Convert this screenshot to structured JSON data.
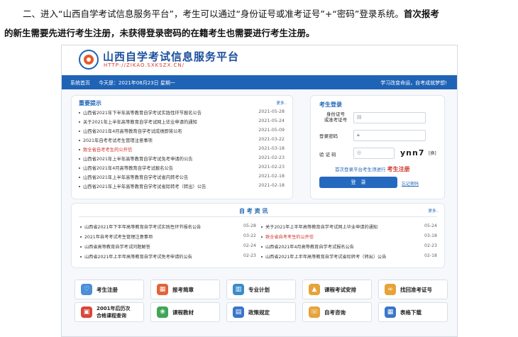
{
  "intro": {
    "line1_normal": "二、进入“山西自学考试信息服务平台”，考生可以通过“身份证号或准考证号”+“密码”登录系统。",
    "line1_bold": "首次报考",
    "line2_bold": "的新生需要先进行考生注册，未获得登录密码的在籍考生也需要进行考生注册。"
  },
  "header": {
    "title": "山西自学考试信息服务平台",
    "url": "HTTP://ZIKAO.SXKSZX.CN/"
  },
  "nav": {
    "home": "系统首页",
    "today": "今天是：2021年08月23日   星期一",
    "slogan": "学习改变命运，自考成就梦想!"
  },
  "notices": {
    "title": "重要提示",
    "more": "更多..",
    "items": [
      {
        "text": "山西省2021年下半年高等教育自学考试实践性环节报名公告",
        "date": "2021-05-28"
      },
      {
        "text": "关于2021年上半年高等教育自学考试网上毕业申请的通知",
        "date": "2021-05-24"
      },
      {
        "text": "山西省2021年4月高等教育自学考试成绩即将公布",
        "date": "2021-05-09"
      },
      {
        "text": "2021年自考考试考生管理注意事项",
        "date": "2021-03-22"
      },
      {
        "text": "致全省自考考生的公开信",
        "date": "2021-03-18"
      },
      {
        "text": "山西省2021年上半年高等教育自学考试免考申请的公告",
        "date": "2021-02-23"
      },
      {
        "text": "山西省2021年4月高等教育自学考试报名公告",
        "date": "2021-02-23"
      },
      {
        "text": "山西省2021年上半年高等教育自学考试省内转考公告",
        "date": "2021-02-18"
      },
      {
        "text": "山西省2021年上半年高等教育自学考试省际转考（转出）公告",
        "date": "2021-02-18"
      }
    ]
  },
  "login": {
    "title": "考生登录",
    "id_label": "身份证号\n或准考证号",
    "password_label": "登录密码",
    "captcha_label": "验 证 码",
    "captcha_text": "ynn7",
    "change": "[换]",
    "register_hint": "首次登录平台考生须进行",
    "register_link": "考生注册",
    "login_button": "登　录",
    "forgot": "忘记密码"
  },
  "news": {
    "title": "自 考 资 讯",
    "more": "更多..",
    "left": [
      {
        "text": "山西省2021年下半年高等教育自学考试实践性环节报名公告",
        "date": "05-28"
      },
      {
        "text": "2021年自考考试考生管理注意事项",
        "date": "03-22"
      },
      {
        "text": "山西省高等教育自学考试问题解答",
        "date": "02-24"
      },
      {
        "text": "山西省2021年上半年高等教育自学考试免考申请的公告",
        "date": "02-23"
      }
    ],
    "right": [
      {
        "text": "关于2021年上半年高等教育自学考试网上毕业申请的通知",
        "date": "05-24"
      },
      {
        "text": "致全省自考考生的公开信",
        "date": "03-18"
      },
      {
        "text": "山西省2021年4月高等教育自学考试报名公告",
        "date": "02-23"
      },
      {
        "text": "山西省2021年上半年高等教育自学考试省际转考（转出）公告",
        "date": "02-18"
      }
    ]
  },
  "tiles": [
    {
      "label": "考生注册",
      "icon": "heart-icon",
      "color": "#4a8fd8"
    },
    {
      "label": "报考简章",
      "icon": "calendar-icon",
      "color": "#e0643a"
    },
    {
      "label": "专业计划",
      "icon": "book-icon",
      "color": "#3a8cc9"
    },
    {
      "label": "课程考试安排",
      "icon": "graduation-cap-icon",
      "color": "#e5a33a"
    },
    {
      "label": "找回准考证号",
      "icon": "link-icon",
      "color": "#e5a33a"
    },
    {
      "label": "2001年后历次合格课程查询",
      "line1": "2001年后历次",
      "line2": "合格课程查询",
      "icon": "lock-icon",
      "color": "#d8463a"
    },
    {
      "label": "课程教材",
      "icon": "textbook-icon",
      "color": "#3fa659"
    },
    {
      "label": "政策规定",
      "icon": "document-icon",
      "color": "#3a76c9"
    },
    {
      "label": "自考咨询",
      "icon": "phone-icon",
      "color": "#e5a33a"
    },
    {
      "label": "表格下载",
      "icon": "table-icon",
      "color": "#3a76c9"
    }
  ]
}
